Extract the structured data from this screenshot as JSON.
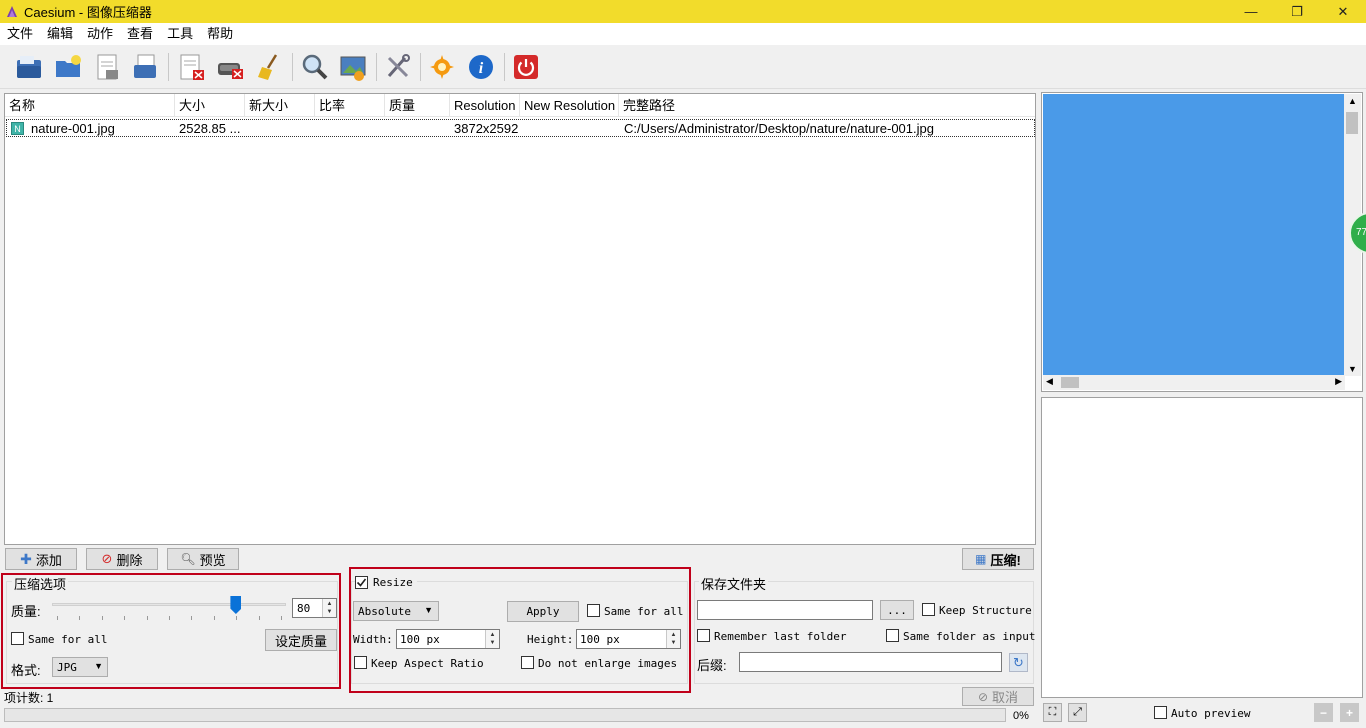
{
  "window": {
    "title": "Caesium - 图像压缩器",
    "minimize": "—",
    "restore": "❐",
    "close": "✕"
  },
  "menu": [
    "文件",
    "编辑",
    "动作",
    "查看",
    "工具",
    "帮助"
  ],
  "toolbar": {
    "icons": [
      "open-file-icon",
      "open-folder-icon",
      "save-icon",
      "save-all-icon",
      "remove-item-icon",
      "clear-list-icon",
      "broom-icon",
      "search-icon",
      "preview-image-icon",
      "tools-icon",
      "update-icon",
      "info-icon",
      "power-icon"
    ]
  },
  "filelist": {
    "columns": [
      "名称",
      "大小",
      "新大小",
      "比率",
      "质量",
      "Resolution",
      "New Resolution",
      "完整路径"
    ],
    "rows": [
      {
        "name": "nature-001.jpg",
        "size": "2528.85 ...",
        "new_size": "",
        "ratio": "",
        "quality": "",
        "resolution": "3872x2592",
        "new_resolution": "",
        "path": "C:/Users/Administrator/Desktop/nature/nature-001.jpg"
      }
    ]
  },
  "buttons": {
    "add": "添加",
    "delete": "删除",
    "preview": "预览",
    "compress": "压缩!",
    "cancel": "取消"
  },
  "compression": {
    "title": "压缩选项",
    "quality_label": "质量:",
    "quality_value": "80",
    "quality_fraction": 0.8,
    "same_for_all": "Same for all",
    "set_quality": "设定质量",
    "format_label": "格式:",
    "format_value": "JPG"
  },
  "resize": {
    "title": "Resize",
    "checked": true,
    "mode": "Absolute",
    "apply": "Apply",
    "same_for_all": "Same for all",
    "width_label": "Width:",
    "width_value": "100 px",
    "height_label": "Height:",
    "height_value": "100 px",
    "keep_aspect": "Keep Aspect Ratio",
    "no_enlarge": "Do not enlarge images"
  },
  "output": {
    "title": "保存文件夹",
    "browse": "...",
    "keep_structure": "Keep Structure",
    "remember_folder": "Remember last folder",
    "same_folder": "Same folder as input",
    "suffix_label": "后缀:"
  },
  "status": {
    "item_count": "项计数: 1",
    "progress_text": "0%"
  },
  "preview": {
    "auto_preview": "Auto preview",
    "badge": "77"
  },
  "colors": {
    "titlebar": "#f2dc2b",
    "preview_blue": "#4a9ae8",
    "highlight_red": "#c0001a"
  }
}
